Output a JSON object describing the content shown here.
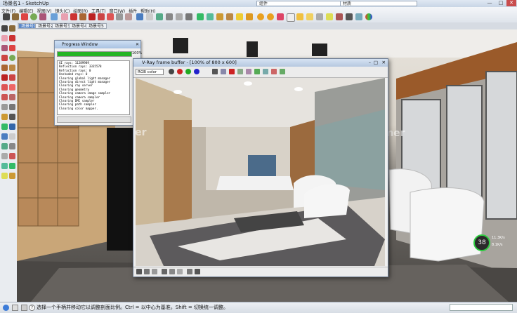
{
  "titlebar": {
    "title": "场景名1 - SketchUp",
    "field_left": "组件",
    "field_right": "材质"
  },
  "menu": [
    "文件(F)",
    "编辑(E)",
    "视图(V)",
    "镜头(C)",
    "绘图(R)",
    "工具(T)",
    "窗口(W)",
    "插件",
    "帮助(H)"
  ],
  "scene_tabs": [
    "场景号1",
    "场景号2",
    "场景号3",
    "场景号4",
    "场景号5"
  ],
  "progress_window": {
    "title": "Progress Window",
    "percent": "100%",
    "progress": 1.0,
    "log": [
      "GI rays: 11289989",
      "Reflection rays: 3335578",
      "Refraction rays: 0",
      "Unshaded rays: 0",
      "Clearing global light manager",
      "Clearing direct light manager",
      "Clearing ray server",
      "Clearing geometry",
      "Clearing camera image sampler",
      "Clearing camera sampler",
      "Clearing DMC sampler",
      "Clearing path sampler",
      "Clearing color mapper."
    ]
  },
  "vray_window": {
    "title": "V-Ray frame buffer - [100% of 800 x 600]",
    "channel": "RGB color"
  },
  "watermark": "hibimer",
  "stats": {
    "value": "38",
    "up": "11.3K/s",
    "down": "8.1K/s"
  },
  "status": {
    "message": "选择一个手柄并移动它以调整剖面比例。Ctrl = 以中心为基准。Shift = 切换统一调整。"
  },
  "colors": {
    "progress_fill": "#25b425",
    "active_tab": "#5d89c8",
    "stats_ring": "#2ecc40"
  }
}
